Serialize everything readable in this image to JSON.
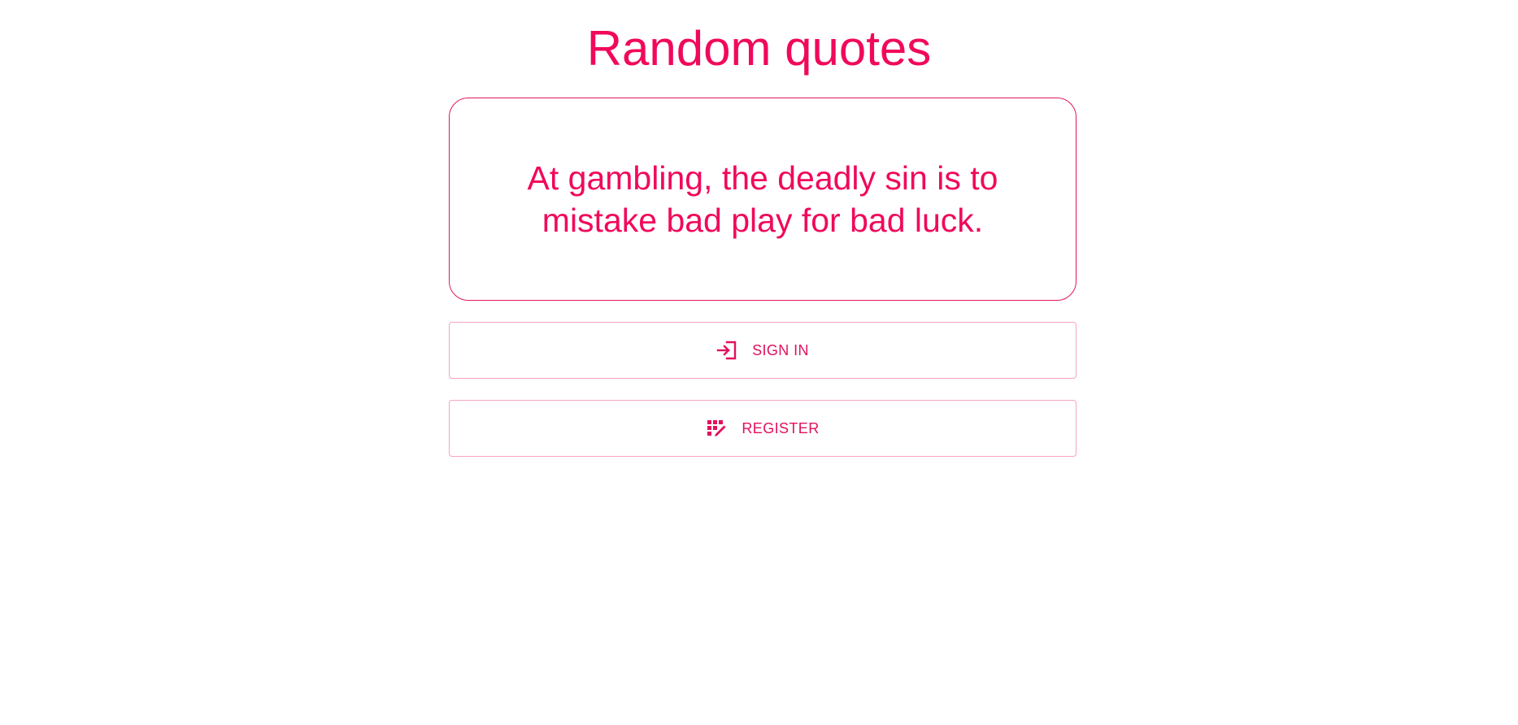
{
  "page": {
    "title": "Random quotes"
  },
  "quote": {
    "text": "At gambling, the deadly sin is to mistake bad play for bad luck."
  },
  "actions": {
    "sign_in": {
      "label": "SIGN IN",
      "icon": "login-icon"
    },
    "register": {
      "label": "REGISTER",
      "icon": "register-icon"
    }
  },
  "colors": {
    "accent": "#f0095b",
    "button_border": "#f6a5c1",
    "background": "#ffffff"
  }
}
